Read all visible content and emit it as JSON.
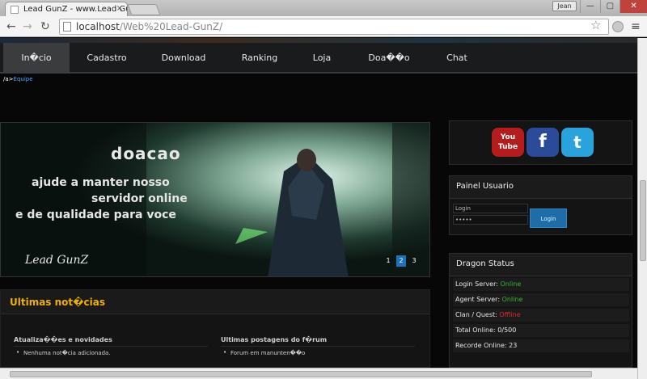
{
  "browser": {
    "tab_title": "Lead GunZ - www.Lead Gu",
    "tab_close": "×",
    "user_chip": "Jean",
    "win_min": "—",
    "win_max": "▢",
    "win_close": "✕",
    "url_host": "localhost",
    "url_path": "/Web%20Lead-GunZ/",
    "back_icon": "arrow-left-icon",
    "forward_icon": "arrow-right-icon",
    "reload_icon": "reload-icon",
    "star_icon": "bookmark-star-icon",
    "menu_icon": "hamburger-menu-icon"
  },
  "nav": {
    "items": [
      "In�cio",
      "Cadastro",
      "Download",
      "Ranking",
      "Loja",
      "Doa��o",
      "Chat"
    ],
    "active_index": 0
  },
  "breadcrumb": {
    "prefix": "/a>",
    "link": "Equipe"
  },
  "banner": {
    "title": "doacao",
    "line1": "ajude a manter nosso",
    "line2": "servidor online",
    "line3": "e de qualidade para voce",
    "logo_text": "Lead GunZ",
    "pager": [
      "1",
      "2",
      "3"
    ],
    "pager_active": 1
  },
  "news": {
    "heading": "Ultimas not�cias",
    "col1_title": "Atualiza��es e novidades",
    "col1_item": "Nenhuma not�cia adicionada.",
    "col2_title": "Ultimas postagens do f�rum",
    "col2_item": "Forum em manunten��o"
  },
  "social": {
    "youtube": "You Tube",
    "facebook": "f",
    "twitter": "t"
  },
  "login": {
    "heading": "Painel Usuario",
    "user_placeholder": "Login",
    "pass_placeholder": "•••••",
    "button": "Login"
  },
  "status": {
    "heading": "Dragon Status",
    "rows": [
      {
        "label": "Login Server:",
        "value": "Online",
        "state": "on"
      },
      {
        "label": "Agent Server:",
        "value": "Online",
        "state": "on"
      },
      {
        "label": "Clan / Quest:",
        "value": "Offline",
        "state": "off"
      },
      {
        "label": "Total Online:",
        "value": "0/500",
        "state": "plain"
      },
      {
        "label": "Recorde Online:",
        "value": "23",
        "state": "plain"
      }
    ]
  },
  "colors": {
    "accent_gold": "#f0b000",
    "online_green": "#35b336",
    "offline_red": "#e02b2b",
    "button_blue": "#1d6ea8"
  }
}
